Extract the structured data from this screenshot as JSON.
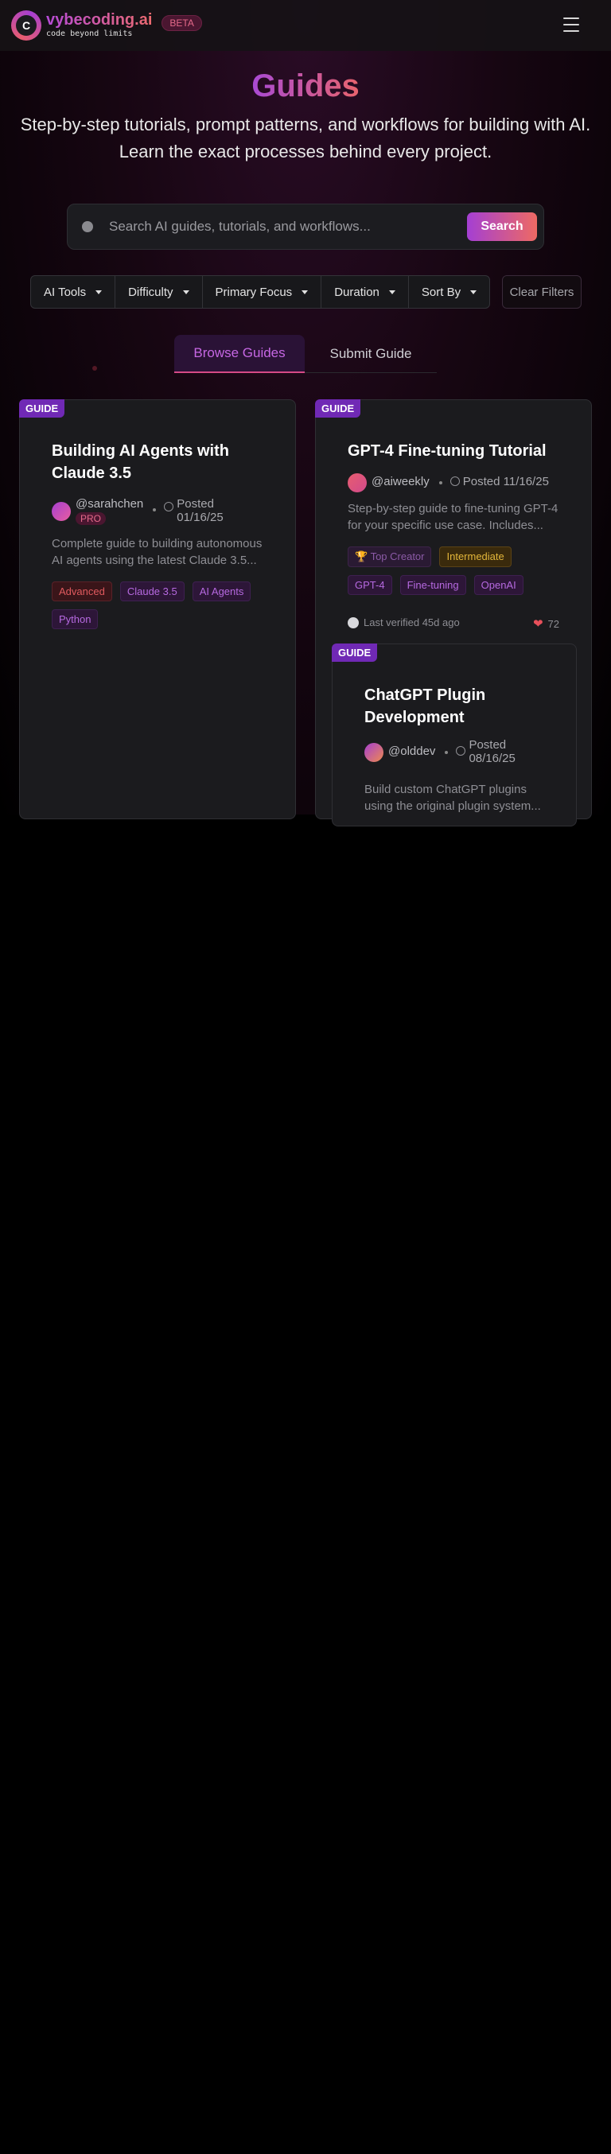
{
  "header": {
    "logo_letter": "C",
    "brand_name": "vybecoding.ai",
    "brand_tagline": "code beyond limits",
    "beta_label": "BETA"
  },
  "hero": {
    "title": "Guides",
    "subtitle": "Step-by-step tutorials, prompt patterns, and workflows for building with AI. Learn the exact processes behind every project."
  },
  "search": {
    "placeholder": "Search AI guides, tutorials, and workflows...",
    "button_label": "Search"
  },
  "filters": {
    "items": [
      "AI Tools",
      "Difficulty",
      "Primary Focus",
      "Duration",
      "Sort By"
    ],
    "clear_label": "Clear Filters"
  },
  "tabs": {
    "active": "Browse Guides",
    "other": "Submit Guide"
  },
  "cards": [
    {
      "badge": "GUIDE",
      "title": "Building AI Agents with Claude 3.5",
      "author": "@sarahchen",
      "author_badge": "PRO",
      "posted": "Posted 01/16/25",
      "description": "Complete guide to building autonomous AI agents using the latest Claude 3.5...",
      "tags": [
        "Advanced",
        "Claude 3.5",
        "AI Agents",
        "Python"
      ]
    },
    {
      "badge": "GUIDE",
      "title": "GPT-4 Fine-tuning Tutorial",
      "author": "@aiweekly",
      "posted": "Posted 11/16/25",
      "description": "Step-by-step guide to fine-tuning GPT-4 for your specific use case. Includes...",
      "tags": [
        "🏆 Top Creator",
        "Intermediate",
        "GPT-4",
        "Fine-tuning",
        "OpenAI"
      ],
      "verified": "Last verified 45d ago",
      "likes": "72"
    },
    {
      "badge": "GUIDE",
      "title": "ChatGPT Plugin Development",
      "author": "@olddev",
      "posted": "Posted 08/16/25",
      "description": "Build custom ChatGPT plugins using the original plugin system..."
    }
  ],
  "colors": {
    "accent_purple": "#a43fd3",
    "accent_coral": "#ee6a63",
    "badge_purple": "#7029b5",
    "background": "#000000"
  }
}
